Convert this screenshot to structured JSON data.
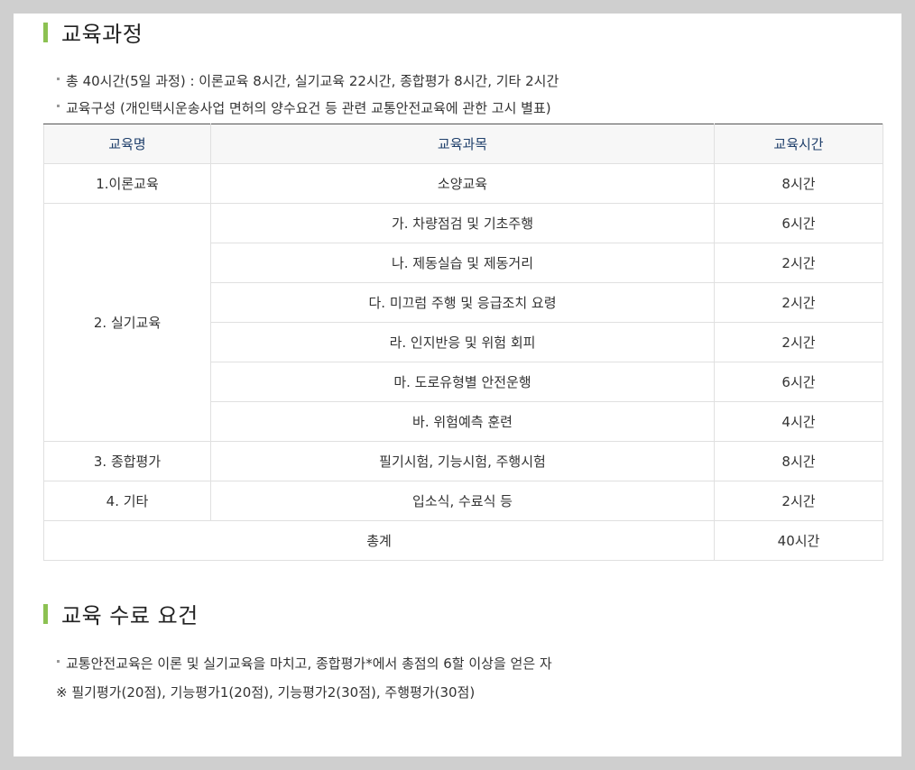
{
  "section1": {
    "title": "교육과정",
    "bullets": [
      "총 40시간(5일 과정) : 이론교육 8시간, 실기교육 22시간, 종합평가 8시간, 기타 2시간",
      "교육구성 (개인택시운송사업 면허의 양수요건 등 관련 교통안전교육에 관한 고시 별표)"
    ]
  },
  "table": {
    "headers": [
      "교육명",
      "교육과목",
      "교육시간"
    ],
    "rows": [
      {
        "name": "1.이론교육",
        "subject": "소양교육",
        "hours": "8시간"
      },
      {
        "name": "2. 실기교육",
        "subject": "가. 차량점검 및 기초주행",
        "hours": "6시간"
      },
      {
        "subject": "나. 제동실습 및 제동거리",
        "hours": "2시간"
      },
      {
        "subject": "다. 미끄럼 주행 및 응급조치 요령",
        "hours": "2시간"
      },
      {
        "subject": "라. 인지반응 및 위험 회피",
        "hours": "2시간"
      },
      {
        "subject": "마. 도로유형별 안전운행",
        "hours": "6시간"
      },
      {
        "subject": "바. 위험예측 훈련",
        "hours": "4시간"
      },
      {
        "name": "3. 종합평가",
        "subject": "필기시험, 기능시험, 주행시험",
        "hours": "8시간"
      },
      {
        "name": "4. 기타",
        "subject": "입소식, 수료식 등",
        "hours": "2시간"
      }
    ],
    "total": {
      "label": "총계",
      "hours": "40시간"
    }
  },
  "section2": {
    "title": "교육 수료 요건",
    "bullet": "교통안전교육은 이론 및 실기교육을 마치고, 종합평가*에서 총점의 6할 이상을 얻은 자",
    "note": "※ 필기평가(20점), 기능평가1(20점), 기능평가2(30점), 주행평가(30점)"
  },
  "colors": {
    "accent_bar": "#8cc152",
    "header_text": "#1f3f6b",
    "page_background": "#cfcfcf"
  }
}
